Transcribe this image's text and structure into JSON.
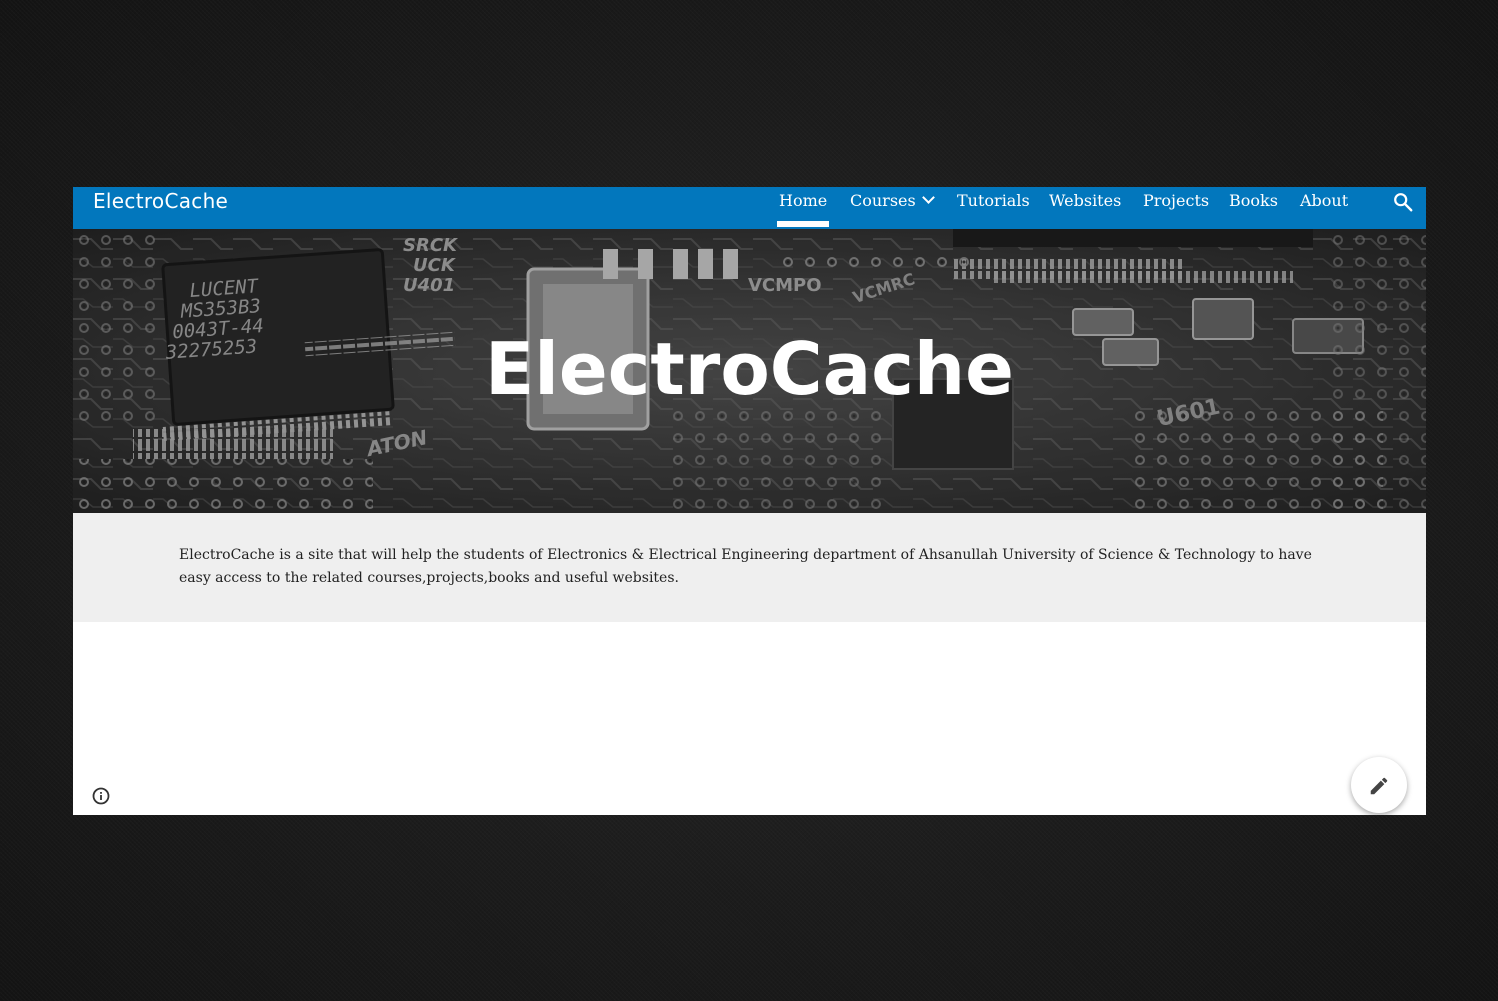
{
  "site": {
    "title": "ElectroCache"
  },
  "nav": {
    "items": [
      {
        "label": "Home",
        "active": true
      },
      {
        "label": "Courses",
        "has_dropdown": true
      },
      {
        "label": "Tutorials"
      },
      {
        "label": "Websites"
      },
      {
        "label": "Projects"
      },
      {
        "label": "Books"
      },
      {
        "label": "About"
      }
    ],
    "search_icon": "search-icon",
    "dropdown_icon": "chevron-down-icon"
  },
  "hero": {
    "title": "ElectroCache",
    "board_text": [
      "LUCENT",
      "MS353B3",
      "0043T-44",
      "32275253",
      "SRCK",
      "UCK",
      "U401",
      "VCMPO",
      "VCMRC",
      "U601",
      "ATON"
    ]
  },
  "intro": {
    "text": "ElectroCache is a site that will help the students of Electronics & Electrical Engineering department of Ahsanullah University of Science & Technology to have easy access to the related courses,projects,books and useful websites."
  },
  "footer": {
    "info_icon": "info-icon",
    "edit_icon": "pencil-icon"
  },
  "colors": {
    "topbar": "#0277bd",
    "intro_bg": "#efefef",
    "page_bg": "#1c1c1c"
  }
}
